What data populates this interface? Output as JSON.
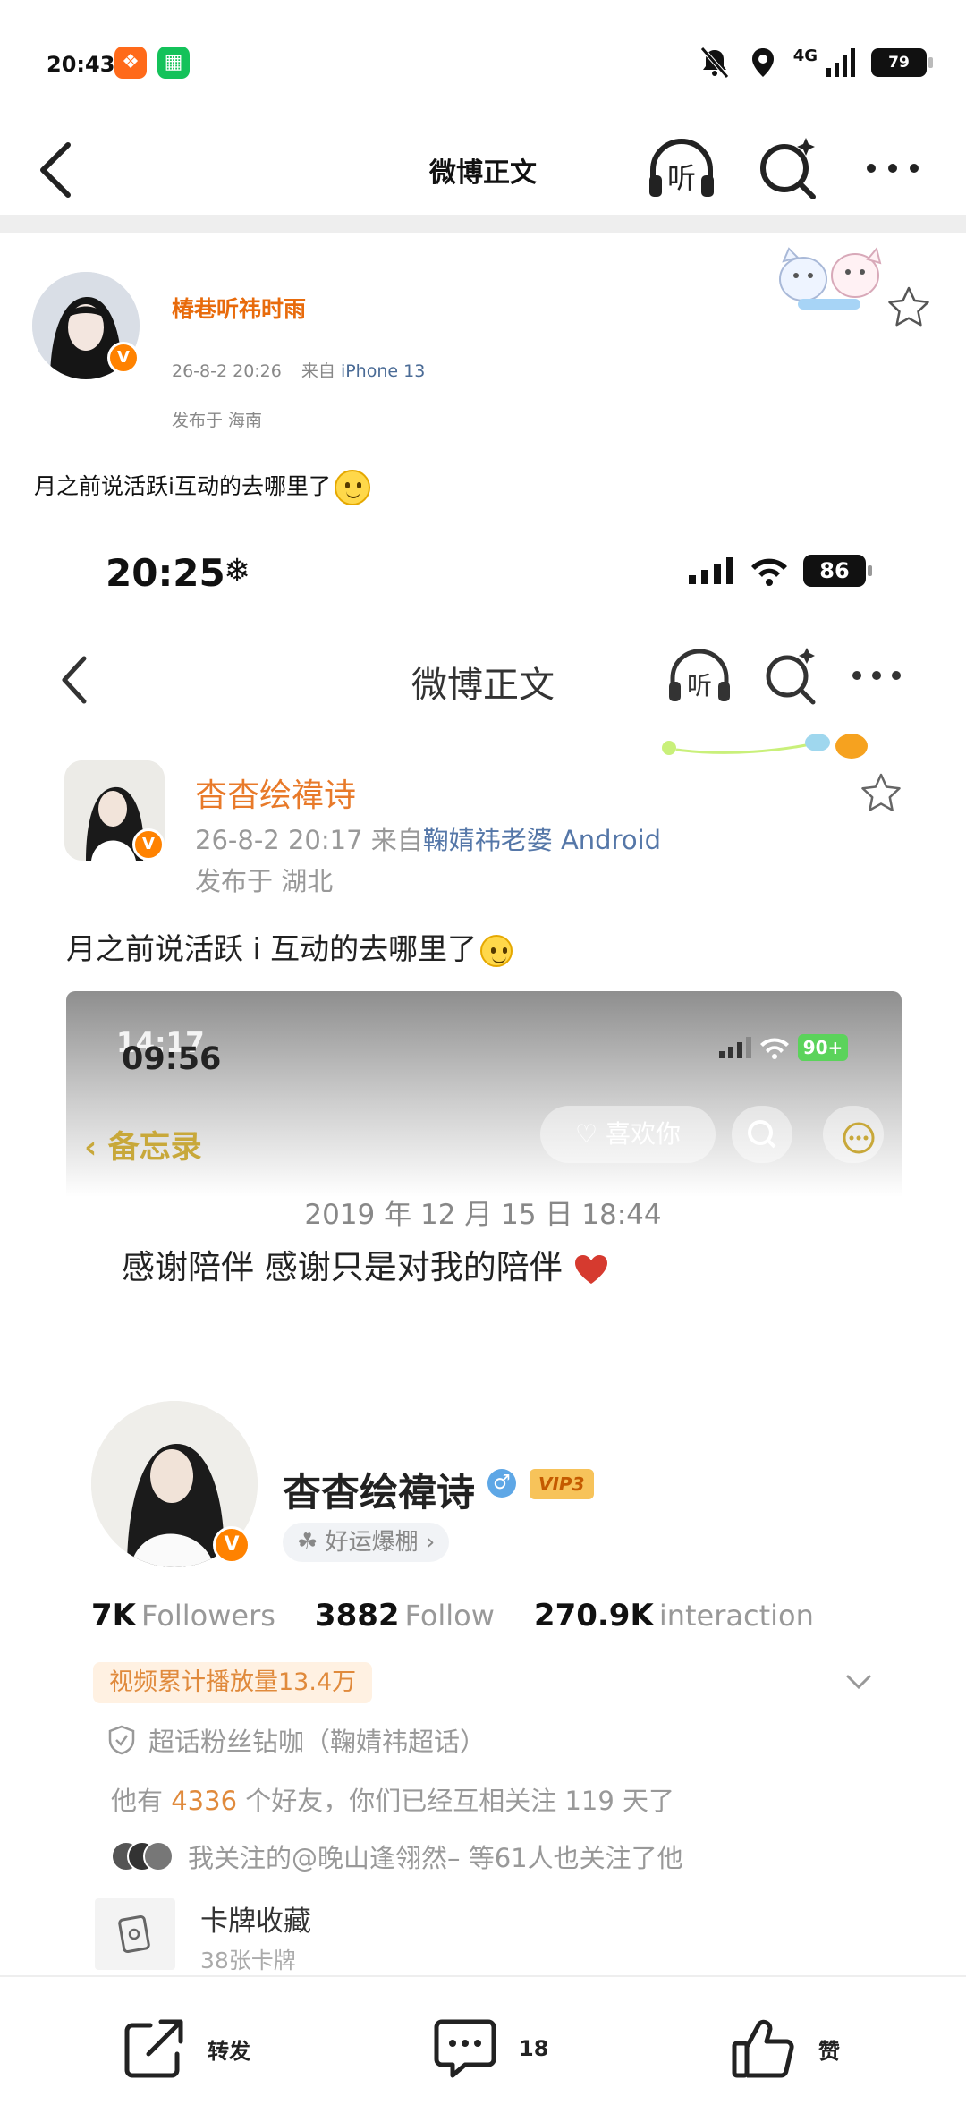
{
  "status_bar": {
    "time": "20:43",
    "network": "4G",
    "battery": "79"
  },
  "nav": {
    "title": "微博正文",
    "listen_label": "听"
  },
  "post": {
    "author": "椿巷听祎时雨",
    "date": "26-8-2 20:26",
    "source_prefix": "来自",
    "source": "iPhone 13",
    "location": "发布于 海南",
    "text": "月之前说活跃i互动的去哪里了"
  },
  "screenshot": {
    "time": "20:25",
    "battery": "86",
    "nav_title": "微博正文",
    "listen_label": "听",
    "author": "杳杳绘禕诗",
    "meta": "26-8-2 20:17  来自",
    "source": "鞠婧祎老婆 Android",
    "location": "发布于 湖北",
    "text": "月之前说活跃 i 互动的去哪里了",
    "memo": {
      "time_a": "14:17",
      "time_b": "09:56",
      "battery": "90+",
      "back_label": "备忘录",
      "like_label": "喜欢你",
      "date": "2019 年 12 月 15 日 18:44",
      "body": "感谢陪伴 感谢只是对我的陪伴"
    },
    "profile": {
      "name": "杳杳绘禕诗",
      "vip": "VIP3",
      "luck_tag": "好运爆棚 ›",
      "followers_num": "7K",
      "followers_label": "Followers",
      "follow_num": "3882",
      "follow_label": "Follow",
      "interaction_num": "270.9K",
      "interaction_label": "interaction",
      "video_plays": "视频累计播放量13.4万",
      "super_fan": "超话粉丝钻咖（鞠婧祎超话）",
      "friends_prefix": "他有",
      "friends_count": "4336",
      "friends_suffix": "个好友，你们已经互相关注 119 天了",
      "mutual": "我关注的@晚山逢翎然– 等61人也关注了他",
      "cards_title": "卡牌收藏",
      "cards_sub": "38张卡牌"
    }
  },
  "actions": {
    "repost": "转发",
    "comments": "18",
    "like": "赞"
  },
  "colors": {
    "accent_orange": "#e86b0c",
    "link_blue": "#4a6b96",
    "vip_orange": "#ff8200"
  },
  "icons": [
    "back-icon",
    "listen-icon",
    "search-sparkle-icon",
    "more-icon",
    "star-icon",
    "repost-icon",
    "comment-icon",
    "like-icon"
  ]
}
